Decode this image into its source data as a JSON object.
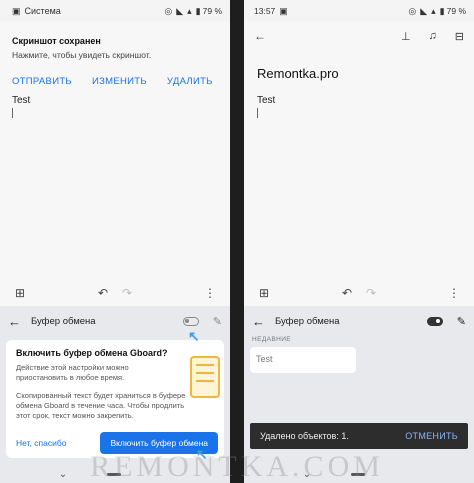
{
  "left": {
    "status": {
      "label": "Система",
      "battery": "79 %"
    },
    "notification": {
      "title": "Скриншот сохранен",
      "subtitle": "Нажмите, чтобы увидеть скриншот.",
      "actions": [
        "ОТПРАВИТЬ",
        "ИЗМЕНИТЬ",
        "УДАЛИТЬ"
      ]
    },
    "note_text": "Test",
    "clipboard": {
      "title": "Буфер обмена",
      "card_title": "Включить буфер обмена Gboard?",
      "card_body_1": "Действие этой настройки можно приостановить в любое время.",
      "card_body_2": "Скопированный текст будет храниться в буфере обмена Gboard в течение часа. Чтобы продлить этот срок, текст можно закрепить.",
      "decline": "Нет, спасибо",
      "accept": "Включить буфер обмена"
    }
  },
  "right": {
    "status": {
      "time": "13:57",
      "battery": "79 %"
    },
    "note_title": "Remontka.pro",
    "note_text": "Test",
    "clipboard": {
      "title": "Буфер обмена",
      "recent_label": "НЕДАВНИЕ",
      "item": "Test"
    },
    "snackbar": {
      "message": "Удалено объектов: 1.",
      "action": "ОТМЕНИТЬ"
    }
  },
  "watermark": "REMONTKA.COM",
  "colors": {
    "accent": "#1a73e8",
    "arrow": "#3b9df5",
    "illustration": "#f2b63b"
  }
}
